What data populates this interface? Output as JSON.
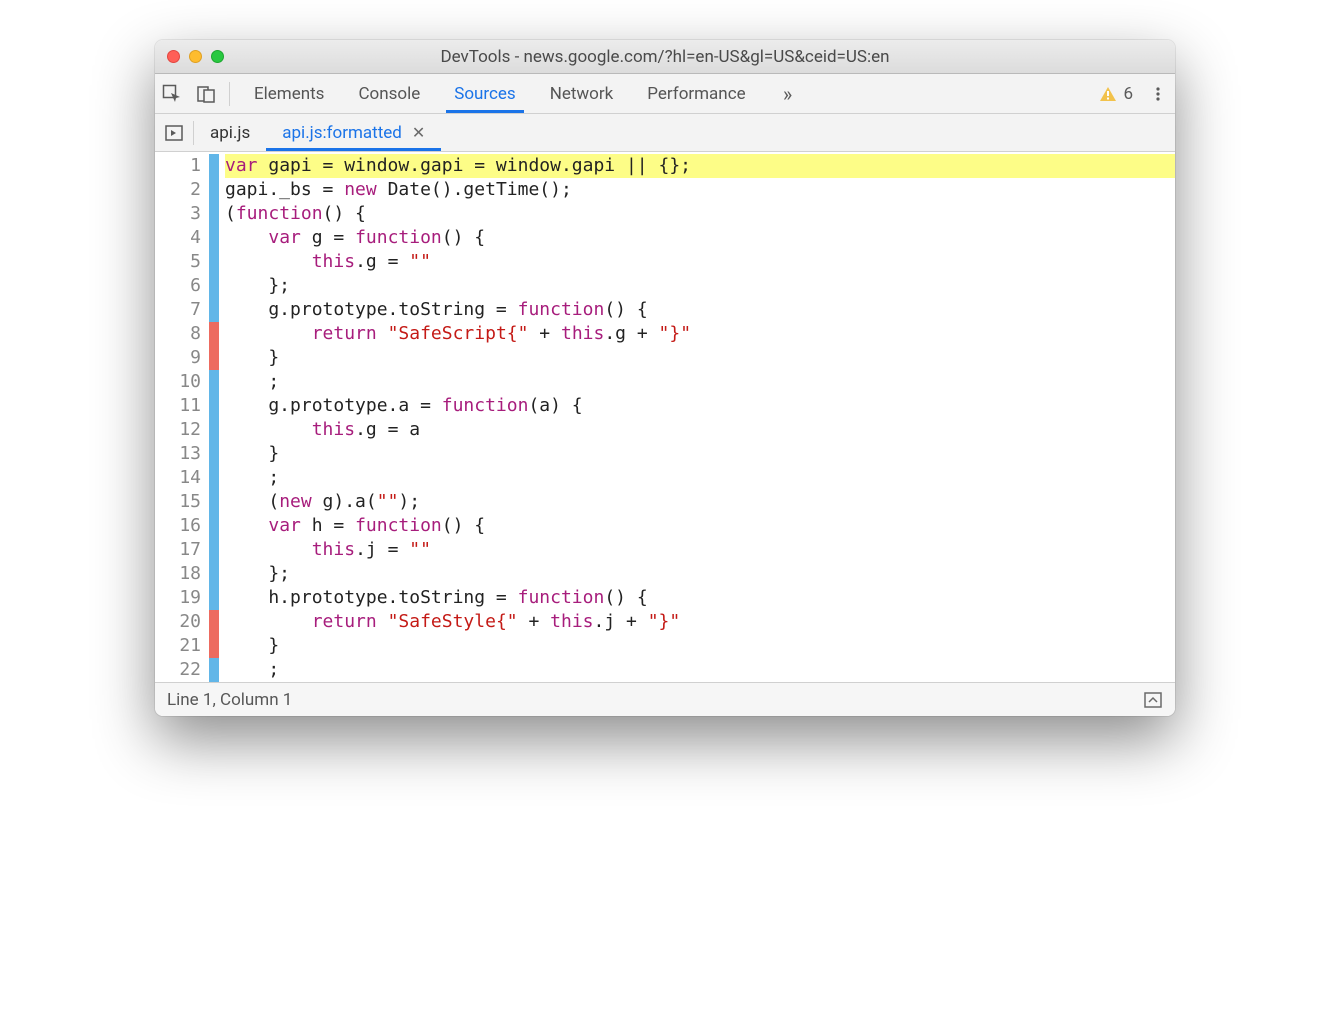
{
  "window": {
    "title": "DevTools - news.google.com/?hl=en-US&gl=US&ceid=US:en"
  },
  "toolbar": {
    "tabs": [
      "Elements",
      "Console",
      "Sources",
      "Network",
      "Performance"
    ],
    "active_tab": "Sources",
    "warning_count": "6"
  },
  "file_tabs": {
    "items": [
      {
        "label": "api.js",
        "active": false,
        "closable": false
      },
      {
        "label": "api.js:formatted",
        "active": true,
        "closable": true
      }
    ]
  },
  "code": {
    "lines": [
      {
        "n": 1,
        "cov": "blue",
        "hl": true,
        "html": "<span class='kw'>var</span> gapi = window.gapi = window.gapi || {};"
      },
      {
        "n": 2,
        "cov": "blue",
        "html": "gapi._bs = <span class='kw'>new</span> Date().getTime();"
      },
      {
        "n": 3,
        "cov": "blue",
        "html": "(<span class='kw'>function</span>() {"
      },
      {
        "n": 4,
        "cov": "blue",
        "html": "    <span class='kw'>var</span> g = <span class='kw'>function</span>() {"
      },
      {
        "n": 5,
        "cov": "blue",
        "html": "        <span class='kw'>this</span>.g = <span class='str'>\"\"</span>"
      },
      {
        "n": 6,
        "cov": "blue",
        "html": "    };"
      },
      {
        "n": 7,
        "cov": "blue",
        "html": "    g.prototype.toString = <span class='kw'>function</span>() {"
      },
      {
        "n": 8,
        "cov": "red",
        "html": "        <span class='kw'>return</span> <span class='str'>\"SafeScript{\"</span> + <span class='kw'>this</span>.g + <span class='str'>\"}\"</span>"
      },
      {
        "n": 9,
        "cov": "red",
        "html": "    }"
      },
      {
        "n": 10,
        "cov": "blue",
        "html": "    ;"
      },
      {
        "n": 11,
        "cov": "blue",
        "html": "    g.prototype.a = <span class='kw'>function</span>(a) {"
      },
      {
        "n": 12,
        "cov": "blue",
        "html": "        <span class='kw'>this</span>.g = a"
      },
      {
        "n": 13,
        "cov": "blue",
        "html": "    }"
      },
      {
        "n": 14,
        "cov": "blue",
        "html": "    ;"
      },
      {
        "n": 15,
        "cov": "blue",
        "html": "    (<span class='kw'>new</span> g).a(<span class='str'>\"\"</span>);"
      },
      {
        "n": 16,
        "cov": "blue",
        "html": "    <span class='kw'>var</span> h = <span class='kw'>function</span>() {"
      },
      {
        "n": 17,
        "cov": "blue",
        "html": "        <span class='kw'>this</span>.j = <span class='str'>\"\"</span>"
      },
      {
        "n": 18,
        "cov": "blue",
        "html": "    };"
      },
      {
        "n": 19,
        "cov": "blue",
        "html": "    h.prototype.toString = <span class='kw'>function</span>() {"
      },
      {
        "n": 20,
        "cov": "red",
        "html": "        <span class='kw'>return</span> <span class='str'>\"SafeStyle{\"</span> + <span class='kw'>this</span>.j + <span class='str'>\"}\"</span>"
      },
      {
        "n": 21,
        "cov": "red",
        "html": "    }"
      },
      {
        "n": 22,
        "cov": "blue",
        "html": "    ;"
      }
    ]
  },
  "status": {
    "text": "Line 1, Column 1"
  }
}
